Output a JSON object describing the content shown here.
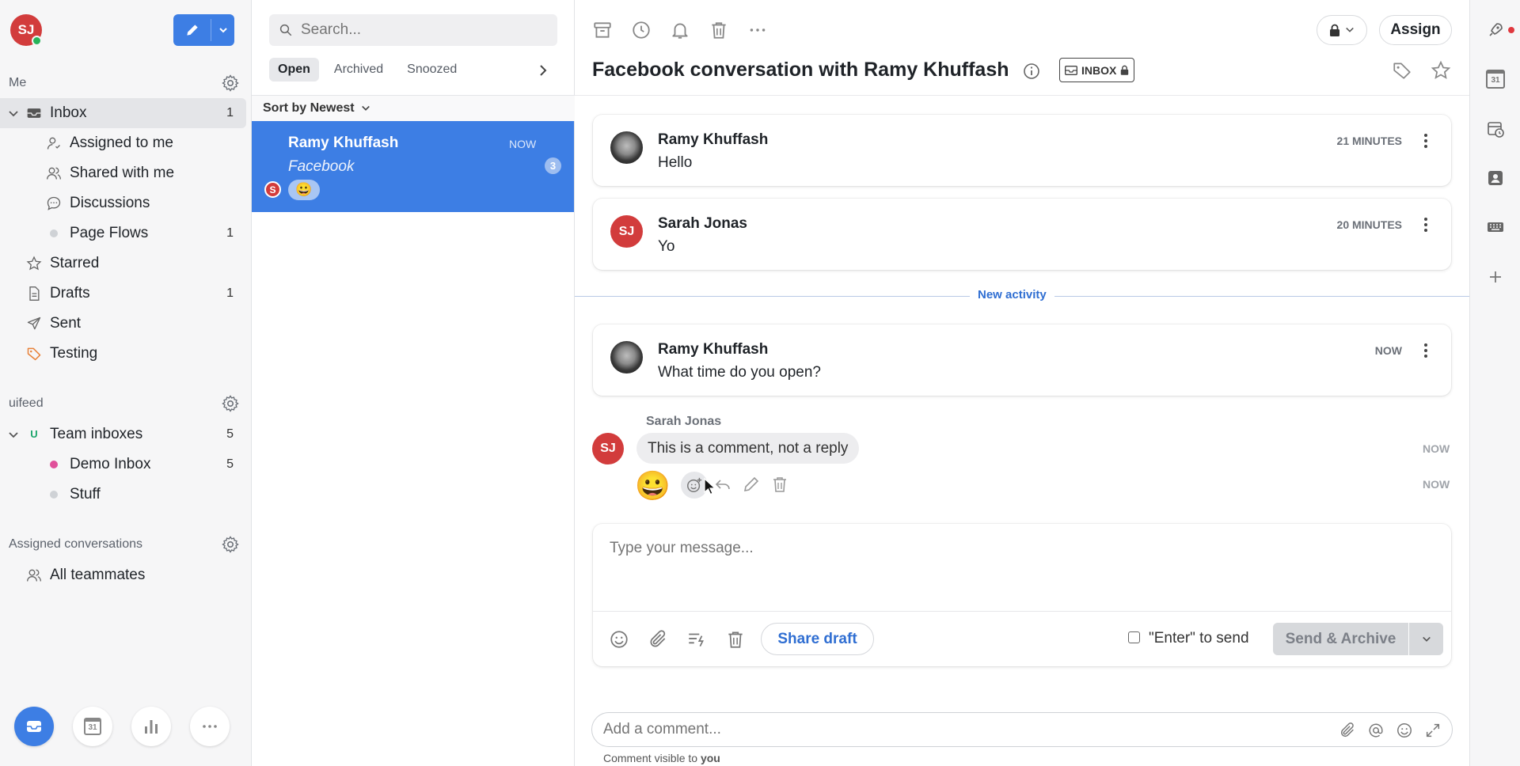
{
  "user": {
    "initials": "SJ"
  },
  "sidebar": {
    "me_title": "Me",
    "inbox": {
      "label": "Inbox",
      "count": "1"
    },
    "items": [
      {
        "label": "Assigned to me",
        "count": ""
      },
      {
        "label": "Shared with me",
        "count": ""
      },
      {
        "label": "Discussions",
        "count": ""
      },
      {
        "label": "Page Flows",
        "count": "1"
      },
      {
        "label": "Starred",
        "count": ""
      },
      {
        "label": "Drafts",
        "count": "1"
      },
      {
        "label": "Sent",
        "count": ""
      },
      {
        "label": "Testing",
        "count": ""
      }
    ],
    "org_title": "uifeed",
    "team_inboxes": {
      "label": "Team inboxes",
      "count": "5",
      "badge": "U"
    },
    "team_items": [
      {
        "label": "Demo Inbox",
        "count": "5",
        "color": "#e0509a"
      },
      {
        "label": "Stuff",
        "count": "",
        "color": "#cfd2d6"
      }
    ],
    "assigned_title": "Assigned conversations",
    "all_teammates": "All teammates",
    "calendar_day": "31"
  },
  "list": {
    "search_placeholder": "Search...",
    "tabs": [
      "Open",
      "Archived",
      "Snoozed"
    ],
    "sort_label": "Sort by Newest",
    "conversations": [
      {
        "name": "Ramy Khuffash",
        "time": "NOW",
        "channel": "Facebook",
        "unread": "3",
        "assignee_initial": "S",
        "reaction": "😀"
      }
    ]
  },
  "main": {
    "title": "Facebook conversation with Ramy Khuffash",
    "inbox_badge": "INBOX",
    "assign_label": "Assign",
    "messages": [
      {
        "name": "Ramy Khuffash",
        "text": "Hello",
        "time": "21 MINUTES"
      },
      {
        "name": "Sarah Jonas",
        "text": "Yo",
        "time": "20 MINUTES",
        "initials": "SJ"
      },
      {
        "name": "Ramy Khuffash",
        "text": "What time do you open?",
        "time": "NOW"
      }
    ],
    "new_activity": "New activity",
    "comment": {
      "author": "Sarah Jonas",
      "initials": "SJ",
      "text": "This is a comment, not a reply",
      "time": "NOW",
      "reaction": "😀",
      "reaction_time": "NOW"
    },
    "composer": {
      "placeholder": "Type your message...",
      "share_draft": "Share draft",
      "enter_to_send": "\"Enter\" to send",
      "send_archive": "Send & Archive"
    },
    "comment_bar": {
      "placeholder": "Add a comment...",
      "visibility_prefix": "Comment visible to",
      "visibility_target": "you"
    }
  },
  "rail": {
    "calendar_day": "31"
  },
  "colors": {
    "accent": "#3d7ee4",
    "avatar": "#d23c3c",
    "link": "#2f6ed2"
  }
}
